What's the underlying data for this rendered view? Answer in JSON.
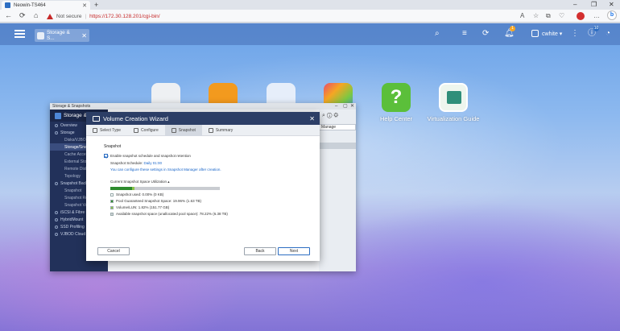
{
  "browser": {
    "tab_title": "Neowin-TS464",
    "tab_close": "✕",
    "new_tab": "+",
    "window_controls": [
      "–",
      "❐",
      "✕"
    ],
    "nav": {
      "back": "←",
      "reload": "⟳",
      "home": "⌂"
    },
    "not_secure": "Not secure",
    "url_sep": "|",
    "url": "https://172.30.128.201/cgi-bin/"
  },
  "qts": {
    "app_tab": "Storage & S...",
    "app_tab_close": "✕",
    "username": "cwhite ▾",
    "notification_count": "1",
    "info_count": "10"
  },
  "desktop_icons": [
    {
      "name": "Help Center",
      "color": "#5bbf3a"
    },
    {
      "name": "Virtualization Guide",
      "color": "#2f8f7a"
    }
  ],
  "storage_window": {
    "title": "Storage & Snapshots",
    "header": "Storage & S",
    "nav_items": [
      {
        "label": "Overview",
        "level": "top"
      },
      {
        "label": "Storage",
        "level": "top"
      },
      {
        "label": "Disks/VJBOD",
        "level": "sub"
      },
      {
        "label": "Storage/Snap",
        "level": "sub",
        "active": true
      },
      {
        "label": "Cache Acceler",
        "level": "sub"
      },
      {
        "label": "External Stora",
        "level": "sub"
      },
      {
        "label": "Remote Disk",
        "level": "sub"
      },
      {
        "label": "Topology",
        "level": "sub"
      },
      {
        "label": "Snapshot Back",
        "level": "top"
      },
      {
        "label": "Snapshot",
        "level": "sub"
      },
      {
        "label": "Snapshot Repl",
        "level": "sub"
      },
      {
        "label": "Snapshot Vault",
        "level": "sub"
      },
      {
        "label": "iSCSI & Fibre C",
        "level": "top"
      },
      {
        "label": "HybridMount",
        "level": "top"
      },
      {
        "label": "SSD Profiling",
        "level": "top"
      },
      {
        "label": "VJBOD Cloud",
        "level": "top"
      }
    ],
    "manage_tab": "Manage"
  },
  "wizard": {
    "title": "Volume Creation Wizard",
    "close": "✕",
    "steps": [
      {
        "label": "Select Type",
        "active": false
      },
      {
        "label": "Configure",
        "active": false
      },
      {
        "label": "Snapshot",
        "active": true
      },
      {
        "label": "Summary",
        "active": false
      }
    ],
    "section_title": "Snapshot",
    "enable_checkbox_label": "Enable snapshot schedule and snapshot retention",
    "schedule_label": "Snapshot Schedule:",
    "schedule_value": "Daily 01:00",
    "note": "You can configure these settings in Snapshot Manager after creation.",
    "utilization_label": "Current Snapshot Space Utilization ▴",
    "utilization": {
      "snapshot_used_pct": 0.0,
      "pool_guaranteed_pct": 19.96,
      "volume_pct": 1.82,
      "available_pct": 78.22
    },
    "legend": [
      {
        "text": "Snapshot used: 0.00% (0 KB)",
        "color": "#ffffff"
      },
      {
        "text": "Pool Guaranteed Snapshot Space: 19.96% (1.63 TB)",
        "color": "#2e8b2e"
      },
      {
        "text": "Volume/LUN: 1.82% (151.77 GB)",
        "color": "#8bc34a"
      },
      {
        "text": "Available snapshot space (unallocated pool space): 78.22% (6.38 TB)",
        "color": "#d0d3d8"
      }
    ],
    "buttons": {
      "cancel": "Cancel",
      "back": "Back",
      "next": "Next"
    }
  }
}
